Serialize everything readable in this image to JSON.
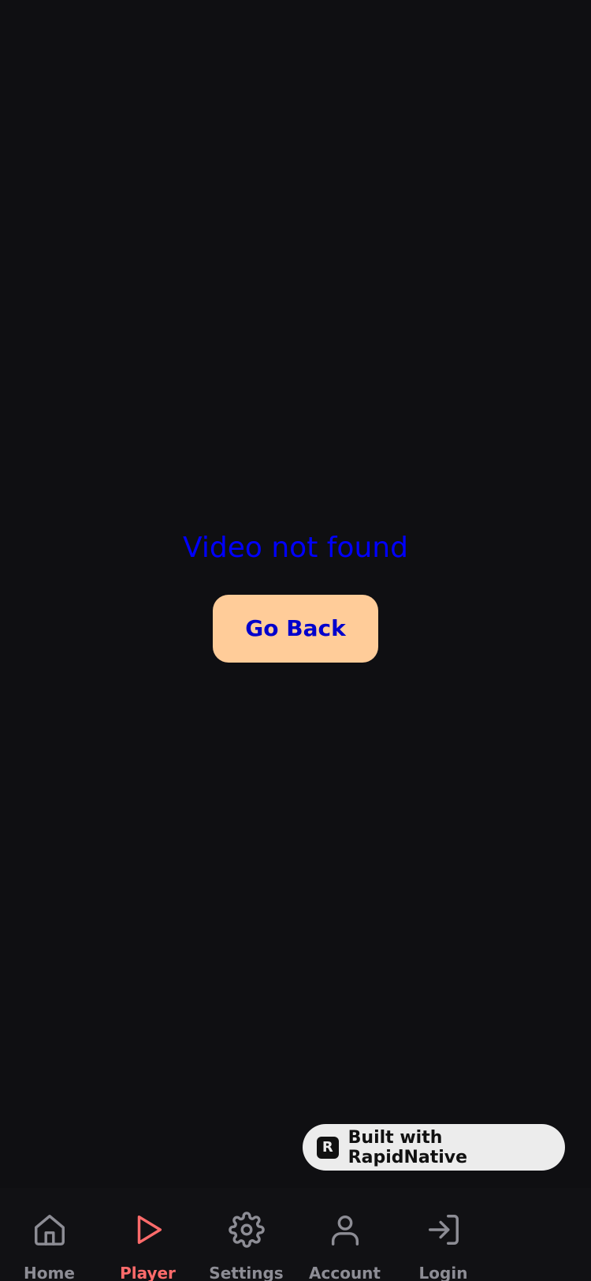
{
  "message": "Video not found",
  "button": {
    "label": "Go Back"
  },
  "badge": {
    "logo_letter": "R",
    "text": "Built with RapidNative"
  },
  "tabs": [
    {
      "name": "home",
      "label": "Home",
      "icon": "home-icon",
      "active": false
    },
    {
      "name": "player",
      "label": "Player",
      "icon": "play-icon",
      "active": true
    },
    {
      "name": "settings",
      "label": "Settings",
      "icon": "gear-icon",
      "active": false
    },
    {
      "name": "account",
      "label": "Account",
      "icon": "user-icon",
      "active": false
    },
    {
      "name": "login",
      "label": "Login",
      "icon": "login-icon",
      "active": false
    }
  ],
  "colors": {
    "background": "#0f0f12",
    "message": "#0000ff",
    "button_bg": "#ffcc99",
    "button_text": "#0000cc",
    "active_tab": "#ff6b6b",
    "inactive_tab": "#8d8d95"
  }
}
